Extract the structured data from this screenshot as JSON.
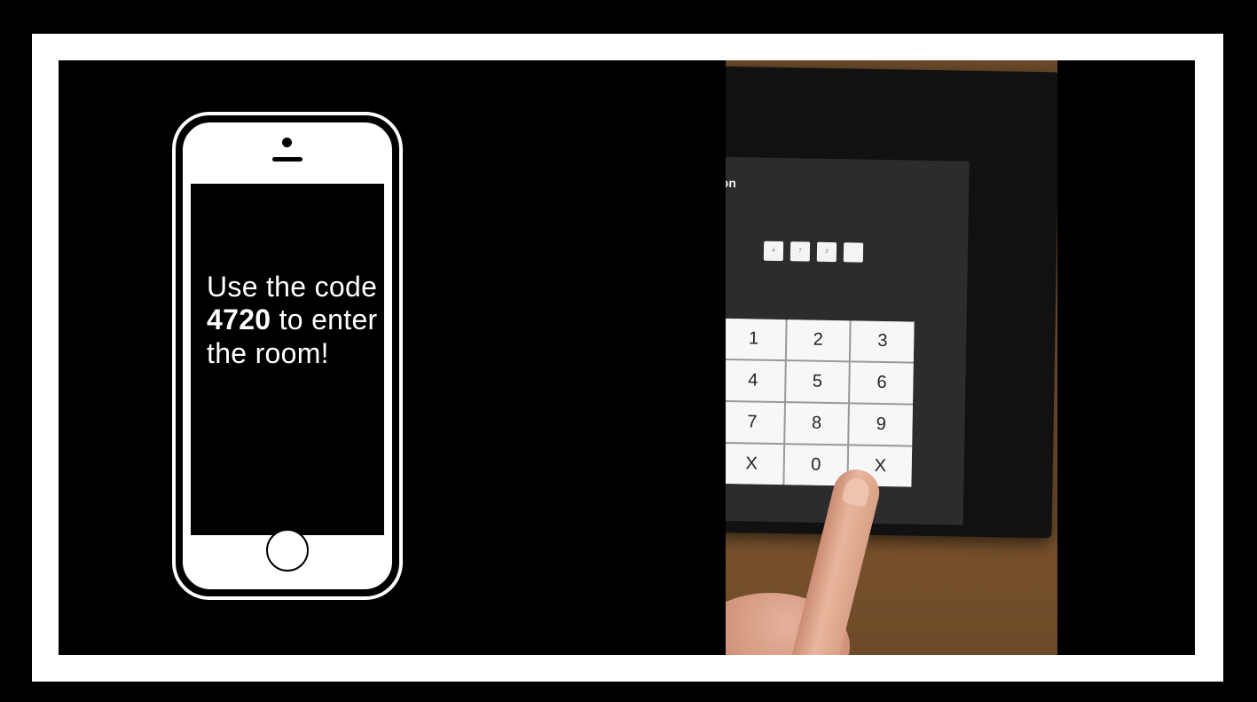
{
  "phone": {
    "message_pre": "Use the code",
    "code": "4720",
    "message_post": "to enter the room!"
  },
  "keypad_screen": {
    "title_fragment": "ıtion",
    "pin_digits": [
      "4",
      "7",
      "2",
      ""
    ],
    "keys": [
      "1",
      "2",
      "3",
      "4",
      "5",
      "6",
      "7",
      "8",
      "9",
      "X",
      "0",
      "X"
    ]
  },
  "colors": {
    "background": "#000000",
    "frame": "#ffffff",
    "wall": "#8a5f35"
  }
}
